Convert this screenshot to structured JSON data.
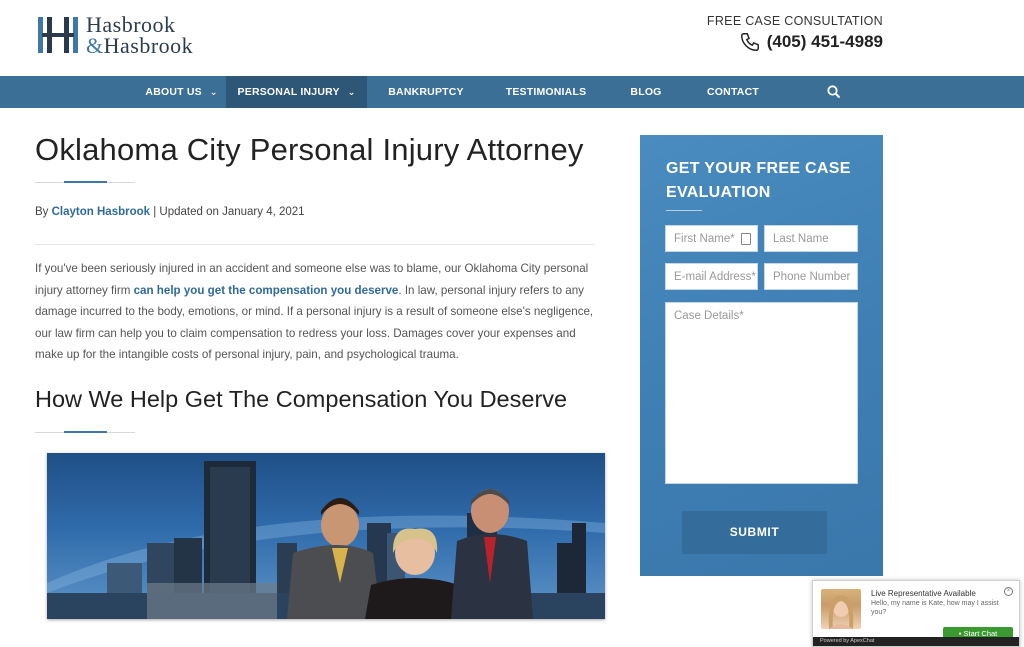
{
  "header": {
    "logo_line1": "Hasbrook",
    "logo_amp": "&",
    "logo_line2": "Hasbrook",
    "consult_label": "FREE CASE CONSULTATION",
    "phone": "(405) 451-4989"
  },
  "nav": {
    "items": [
      {
        "label": "ABOUT US"
      },
      {
        "label": "PERSONAL INJURY"
      },
      {
        "label": "BANKRUPTCY"
      },
      {
        "label": "TESTIMONIALS"
      },
      {
        "label": "BLOG"
      },
      {
        "label": "CONTACT"
      }
    ],
    "chevron": "⌄",
    "colors": {
      "bar": "#3b6f96",
      "active": "#2d5677"
    }
  },
  "article": {
    "title": "Oklahoma City Personal Injury Attorney",
    "by_prefix": "By",
    "author": "Clayton Hasbrook",
    "updated": "| Updated on January 4, 2021",
    "para_part1": "If you've been seriously injured in an accident and someone else was to blame, our Oklahoma City personal injury attorney firm",
    "para_link": "can help you get the compensation you deserve",
    "para_part2": ". In law, personal injury refers to any damage incurred to the body, emotions, or mind. If a personal injury is a result of someone else's negligence, our law firm can help you to claim compensation to redress your loss. Damages cover your expenses and make up for the intangible costs of personal injury, pain, and psychological trauma.",
    "subtitle": "How We Help Get The Compensation You Deserve"
  },
  "form": {
    "title": "GET YOUR FREE CASE EVALUATION",
    "first_name": "First Name*",
    "last_name": "Last Name",
    "email": "E-mail Address*",
    "phone": "Phone Number",
    "details": "Case Details*",
    "submit": "SUBMIT"
  },
  "chat": {
    "status": "Live Representative Available",
    "message": "Hello, my name is Kate, how may I assist you?",
    "button": "Start Chat",
    "powered": "Powered by ApexChat"
  }
}
